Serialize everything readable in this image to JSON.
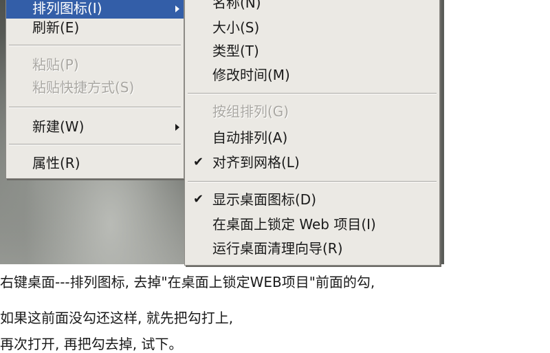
{
  "context_menu": {
    "items": [
      {
        "label": "排列图标(I)",
        "state": "highlighted",
        "submenu": true
      },
      {
        "label": "刷新(E)",
        "state": "normal"
      },
      {
        "label": "粘贴(P)",
        "state": "disabled"
      },
      {
        "label": "粘贴快捷方式(S)",
        "state": "disabled"
      },
      {
        "label": "新建(W)",
        "state": "normal",
        "submenu": true
      },
      {
        "label": "属性(R)",
        "state": "normal"
      }
    ]
  },
  "arrange_submenu": {
    "items": [
      {
        "label": "名称(N)",
        "state": "normal"
      },
      {
        "label": "大小(S)",
        "state": "normal"
      },
      {
        "label": "类型(T)",
        "state": "normal"
      },
      {
        "label": "修改时间(M)",
        "state": "normal"
      },
      {
        "label": "按组排列(G)",
        "state": "disabled"
      },
      {
        "label": "自动排列(A)",
        "state": "normal"
      },
      {
        "label": "对齐到网格(L)",
        "state": "checked"
      },
      {
        "label": "显示桌面图标(D)",
        "state": "checked"
      },
      {
        "label": "在桌面上锁定 Web 项目(I)",
        "state": "normal"
      },
      {
        "label": "运行桌面清理向导(R)",
        "state": "normal"
      }
    ]
  },
  "caption": {
    "line1": "右键桌面---排列图标, 去掉\"在桌面上锁定WEB项目\"前面的勾,",
    "line2": "如果这前面没勾还这样, 就先把勾打上,",
    "line3": "再次打开, 再把勾去掉, 试下。"
  },
  "colors": {
    "menu_bg": "#ebe9e4",
    "highlight": "#335ea8",
    "disabled_text": "#a9a7a2"
  },
  "icons": [
    "submenu-arrow-icon",
    "checkmark-icon"
  ]
}
